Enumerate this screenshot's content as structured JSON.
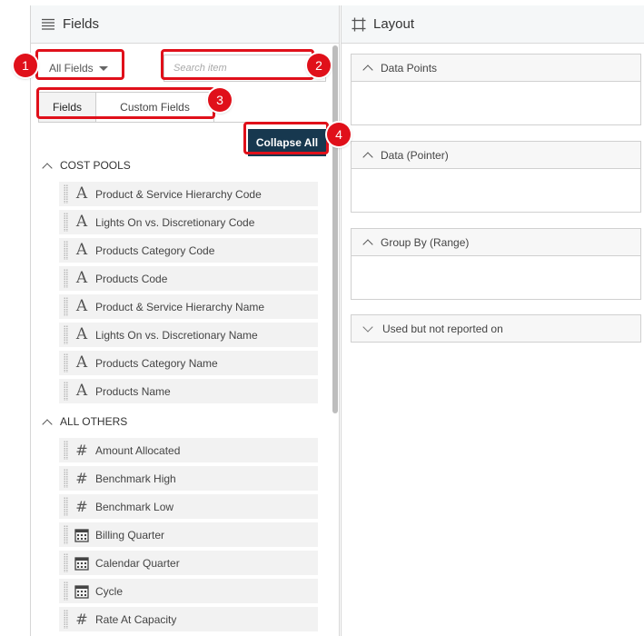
{
  "fields_panel": {
    "title": "Fields",
    "dropdown_label": "All Fields",
    "search_placeholder": "Search item",
    "tabs": [
      {
        "label": "Fields"
      },
      {
        "label": "Custom Fields"
      }
    ],
    "collapse_label": "Collapse All",
    "groups": [
      {
        "label": "COST POOLS",
        "items": [
          {
            "label": "Product & Service Hierarchy Code",
            "icon": "text-icon"
          },
          {
            "label": "Lights On vs. Discretionary Code",
            "icon": "text-icon"
          },
          {
            "label": "Products Category Code",
            "icon": "text-icon"
          },
          {
            "label": "Products Code",
            "icon": "text-icon"
          },
          {
            "label": "Product & Service Hierarchy Name",
            "icon": "text-icon"
          },
          {
            "label": "Lights On vs. Discretionary Name",
            "icon": "text-icon"
          },
          {
            "label": "Products Category Name",
            "icon": "text-icon"
          },
          {
            "label": "Products Name",
            "icon": "text-icon"
          }
        ]
      },
      {
        "label": "ALL OTHERS",
        "items": [
          {
            "label": "Amount Allocated",
            "icon": "number-icon"
          },
          {
            "label": "Benchmark High",
            "icon": "number-icon"
          },
          {
            "label": "Benchmark Low",
            "icon": "number-icon"
          },
          {
            "label": "Billing Quarter",
            "icon": "calendar-icon"
          },
          {
            "label": "Calendar Quarter",
            "icon": "calendar-icon"
          },
          {
            "label": "Cycle",
            "icon": "calendar-icon"
          },
          {
            "label": "Rate At Capacity",
            "icon": "number-icon"
          }
        ]
      }
    ]
  },
  "layout_panel": {
    "title": "Layout",
    "sections": [
      {
        "label": "Data Points",
        "expanded": true
      },
      {
        "label": "Data (Pointer)",
        "expanded": true
      },
      {
        "label": "Group By (Range)",
        "expanded": true
      },
      {
        "label": "Used but not reported on",
        "expanded": false
      }
    ]
  },
  "annotations": [
    {
      "number": "1"
    },
    {
      "number": "2"
    },
    {
      "number": "3"
    },
    {
      "number": "4"
    }
  ],
  "colors": {
    "annotation_red": "#e0101a",
    "collapse_button_bg": "#17384f",
    "header_bg": "#f5f7f8",
    "field_item_bg": "#f2f2f2"
  }
}
